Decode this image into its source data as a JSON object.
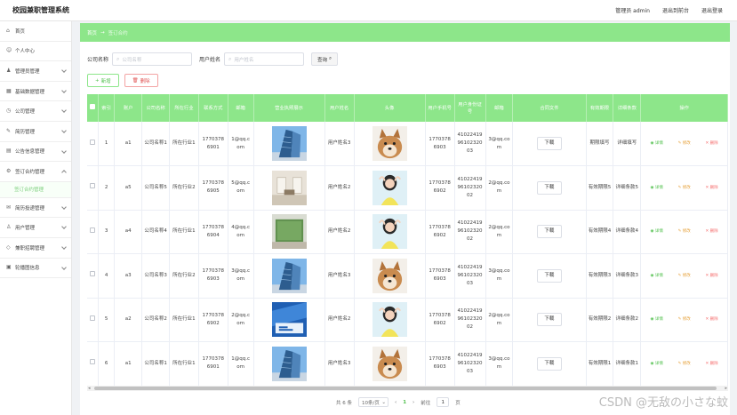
{
  "app": {
    "title": "校园兼职管理系统"
  },
  "header": {
    "admin_label": "管理员 admin",
    "back_label": "退出到前台",
    "logout_label": "退出登录"
  },
  "sidebar": {
    "items": [
      {
        "label": "首页",
        "icon": "home-icon"
      },
      {
        "label": "个人中心",
        "icon": "user-icon"
      },
      {
        "label": "管理员管理",
        "icon": "admin-icon"
      },
      {
        "label": "基础数据管理",
        "icon": "data-icon"
      },
      {
        "label": "公司管理",
        "icon": "company-icon"
      },
      {
        "label": "简历管理",
        "icon": "resume-icon"
      },
      {
        "label": "公告信息管理",
        "icon": "notice-icon"
      },
      {
        "label": "签订合约管理",
        "icon": "contract-icon",
        "sub": "签订合约管理"
      },
      {
        "label": "简历投递管理",
        "icon": "send-icon"
      },
      {
        "label": "用户管理",
        "icon": "users-icon"
      },
      {
        "label": "兼职招聘管理",
        "icon": "job-icon"
      },
      {
        "label": "轮播图信息",
        "icon": "carousel-icon"
      }
    ]
  },
  "breadcrumb": {
    "home": "首页",
    "arrow": "→",
    "current": "签订合约"
  },
  "filters": {
    "company_label": "公司名称",
    "company_placeholder": "公司名称",
    "user_label": "用户姓名",
    "user_placeholder": "用户姓名",
    "query_label": "查询"
  },
  "actions": {
    "add_label": "新增",
    "delete_label": "删除"
  },
  "table": {
    "headers": [
      "",
      "索引",
      "账户",
      "公司名称",
      "所在行业",
      "联系方式",
      "邮箱",
      "营业执照展示",
      "用户姓名",
      "头像",
      "用户手机号",
      "用户身份证号",
      "邮箱",
      "合同文件",
      "有效期限",
      "详细条款",
      "操作"
    ],
    "rows": [
      {
        "idx": "1",
        "account": "a1",
        "company": "公司名称1",
        "industry": "所在行业1",
        "phone": "17703786901",
        "email": "1@qq.com",
        "license": "building",
        "user": "用户姓名3",
        "avatar": "dog",
        "uphone": "17703786903",
        "idcard": "410224199610232003",
        "uemail": "3@qq.com",
        "file": "下载",
        "valid": "期限填写",
        "terms": "详细填写"
      },
      {
        "idx": "2",
        "account": "a5",
        "company": "公司名称5",
        "industry": "所在行业2",
        "phone": "17703786905",
        "email": "5@qq.com",
        "license": "lobby",
        "user": "用户姓名2",
        "avatar": "girl",
        "uphone": "17703786902",
        "idcard": "410224199610232002",
        "uemail": "2@qq.com",
        "file": "下载",
        "valid": "有效期限5",
        "terms": "详细条款5"
      },
      {
        "idx": "3",
        "account": "a4",
        "company": "公司名称4",
        "industry": "所在行业1",
        "phone": "17703786904",
        "email": "4@qq.com",
        "license": "wall",
        "user": "用户姓名2",
        "avatar": "girl",
        "uphone": "17703786902",
        "idcard": "410224199610232002",
        "uemail": "2@qq.com",
        "file": "下载",
        "valid": "有效期限4",
        "terms": "详细条款4"
      },
      {
        "idx": "4",
        "account": "a3",
        "company": "公司名称3",
        "industry": "所在行业2",
        "phone": "17703786903",
        "email": "3@qq.com",
        "license": "building",
        "user": "用户姓名3",
        "avatar": "dog",
        "uphone": "17703786903",
        "idcard": "410224199610232003",
        "uemail": "3@qq.com",
        "file": "下载",
        "valid": "有效期限3",
        "terms": "详细条款3"
      },
      {
        "idx": "5",
        "account": "a2",
        "company": "公司名称2",
        "industry": "所在行业1",
        "phone": "17703786902",
        "email": "2@qq.com",
        "license": "blue",
        "user": "用户姓名2",
        "avatar": "girl",
        "uphone": "17703786902",
        "idcard": "410224199610232002",
        "uemail": "2@qq.com",
        "file": "下载",
        "valid": "有效期限2",
        "terms": "详细条款2"
      },
      {
        "idx": "6",
        "account": "a1",
        "company": "公司名称1",
        "industry": "所在行业1",
        "phone": "17703786901",
        "email": "1@qq.com",
        "license": "building",
        "user": "用户姓名3",
        "avatar": "dog",
        "uphone": "17703786903",
        "idcard": "410224199610232003",
        "uemail": "3@qq.com",
        "file": "下载",
        "valid": "有效期限1",
        "terms": "详细条款1"
      }
    ],
    "ops": {
      "detail": "详情",
      "edit": "修改",
      "delete": "删除"
    }
  },
  "pager": {
    "total": "共 6 条",
    "size": "10条/页",
    "prev": "‹",
    "page": "1",
    "next": "›",
    "goto_label": "前往",
    "goto_value": "1",
    "page_unit": "页"
  },
  "watermark": "CSDN @无敌の小さな蚊",
  "colors": {
    "accent": "#8de68a",
    "detail": "#52c04e",
    "edit": "#e6a23c",
    "delete": "#f56c6c"
  }
}
